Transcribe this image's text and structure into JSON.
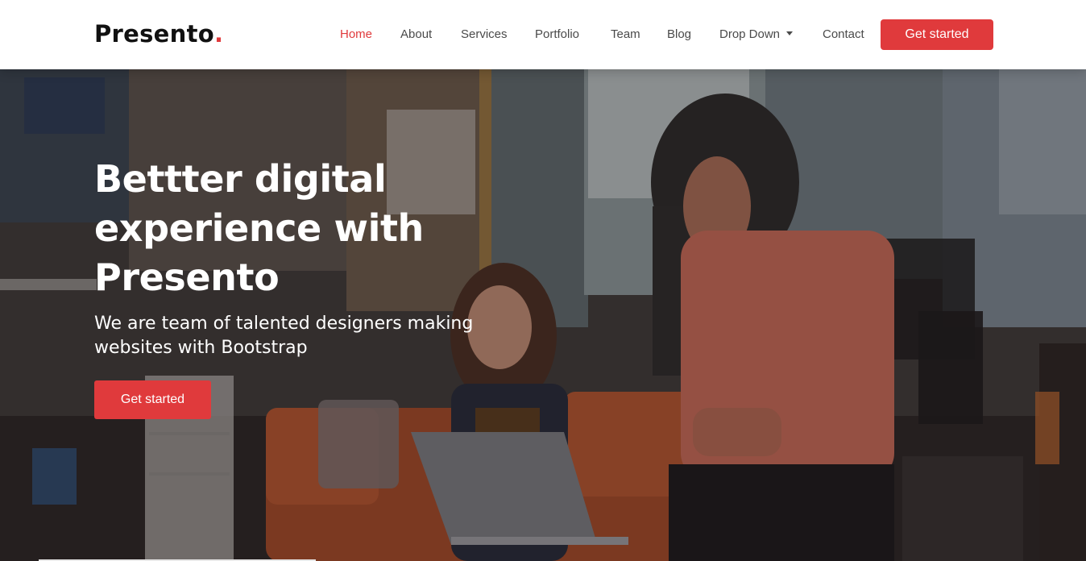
{
  "brand": {
    "name": "Presento",
    "dot": "."
  },
  "nav": {
    "items": [
      {
        "label": "Home",
        "active": true
      },
      {
        "label": "About"
      },
      {
        "label": "Services"
      },
      {
        "label": "Portfolio"
      },
      {
        "label": "Team"
      },
      {
        "label": "Blog"
      },
      {
        "label": "Drop Down",
        "has_dropdown": true
      },
      {
        "label": "Contact"
      }
    ],
    "cta_label": "Get started"
  },
  "hero": {
    "title_lines": [
      "Bettter digital",
      "experience with",
      "Presento"
    ],
    "subtitle": "We are team of talented designers making websites with Bootstrap",
    "cta_label": "Get started"
  },
  "colors": {
    "accent": "#e03a3c",
    "nav_text": "#4a4a4a",
    "header_bg": "#ffffff"
  }
}
